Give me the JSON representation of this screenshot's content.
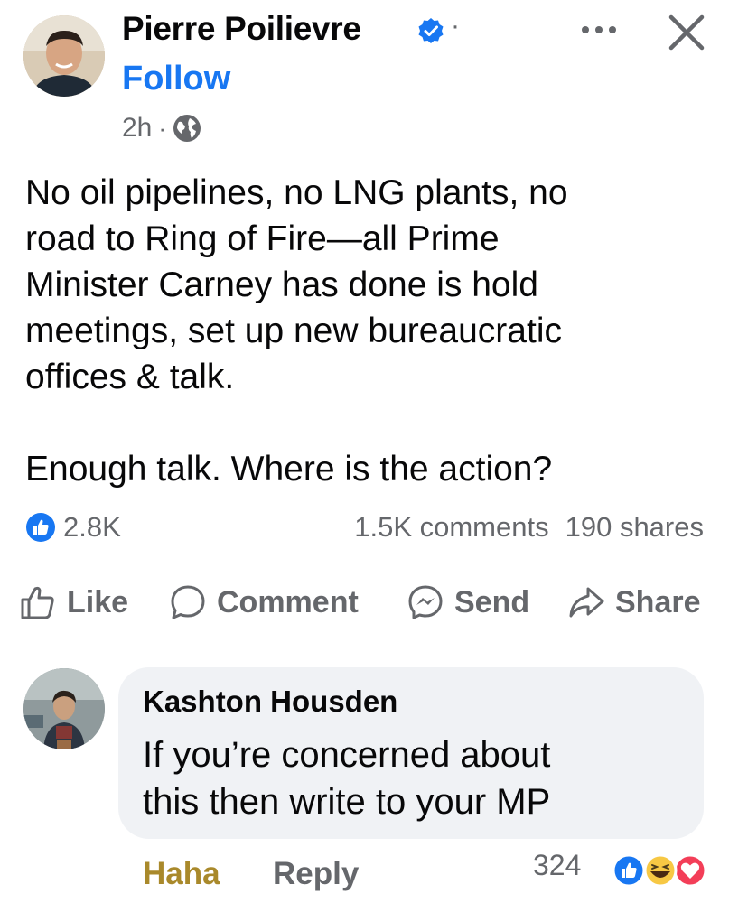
{
  "post": {
    "author": "Pierre Poilievre",
    "separator": "·",
    "follow_label": "Follow",
    "time": "2h",
    "time_separator": "·",
    "audience_icon": "globe-icon",
    "paragraphs": [
      "No oil pipelines, no LNG plants, no\nroad to Ring of Fire—all Prime\nMinister Carney has done is hold\nmeetings, set up new bureaucratic\noffices & talk.",
      "Enough talk. Where is the action?"
    ]
  },
  "stats": {
    "reactions": "2.8K",
    "comments": "1.5K comments",
    "shares": "190 shares"
  },
  "actions": {
    "like": "Like",
    "comment": "Comment",
    "send": "Send",
    "share": "Share"
  },
  "comment": {
    "author": "Kashton Housden",
    "text": "If you’re concerned about\nthis then write to your MP",
    "reaction_label": "Haha",
    "reply_label": "Reply",
    "reaction_count": "324"
  },
  "colors": {
    "brand_blue": "#1877f2",
    "secondary_text": "#65676b",
    "haha_gold": "#a9892b",
    "bubble_bg": "#f0f2f5",
    "love_red": "#f33e58"
  }
}
